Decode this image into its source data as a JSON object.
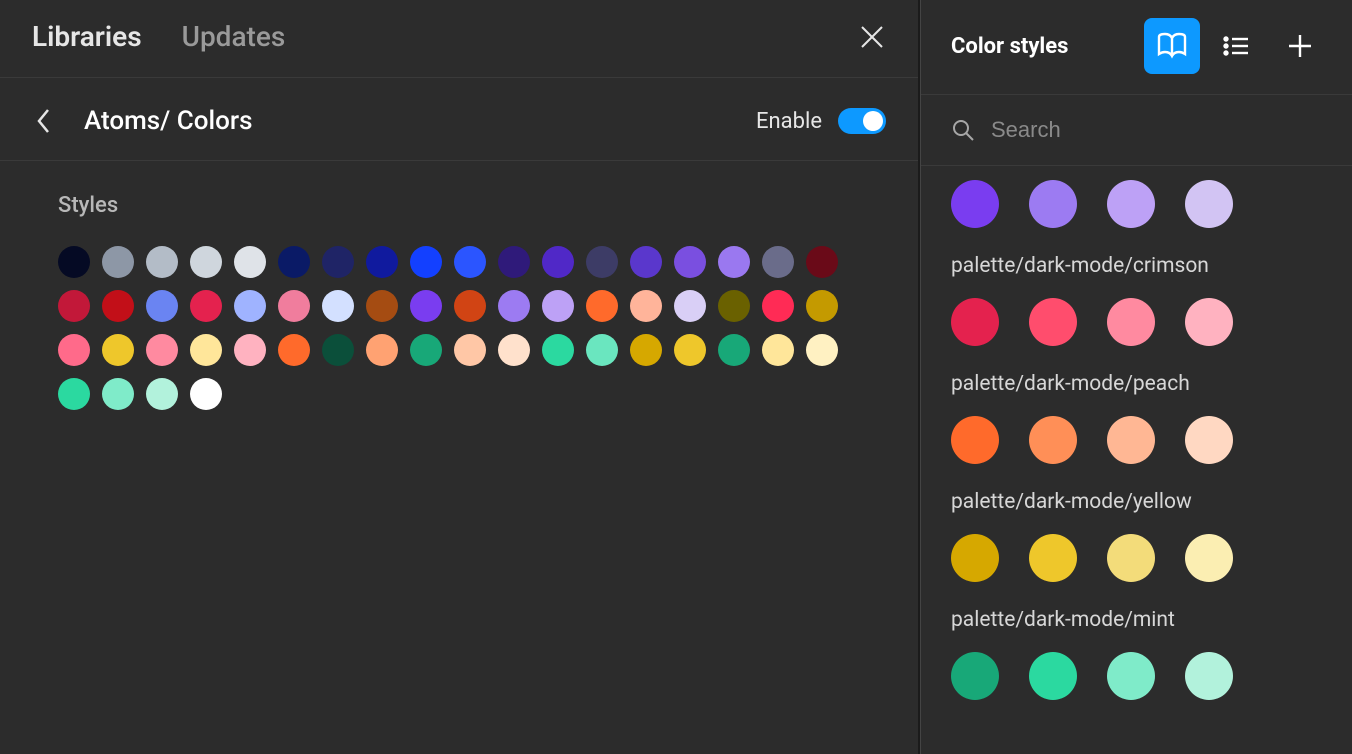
{
  "tabs": {
    "libraries": "Libraries",
    "updates": "Updates"
  },
  "library": {
    "title": "Atoms/ Colors",
    "enable_label": "Enable",
    "enabled": true
  },
  "styles_section": {
    "heading": "Styles",
    "swatches": [
      "#050a24",
      "#8d97a6",
      "#b3bcc7",
      "#cfd6dd",
      "#dfe3e8",
      "#0a1a66",
      "#1f2466",
      "#101a9e",
      "#1340ff",
      "#2b55ff",
      "#2f1a7a",
      "#5028c7",
      "#3d3c66",
      "#5a37cc",
      "#7a4fe0",
      "#9a78f0",
      "#6a6c8a",
      "#6a0a18",
      "#c21839",
      "#c20f18",
      "#6a84f2",
      "#e4224e",
      "#9fb3ff",
      "#f07d9d",
      "#d3e0ff",
      "#a54c12",
      "#7a3df0",
      "#d14414",
      "#9c7bf2",
      "#bda1f6",
      "#ff6a2b",
      "#ffb49a",
      "#d9cff6",
      "#6a6100",
      "#ff2b55",
      "#c49a00",
      "#ff6a8a",
      "#eec72b",
      "#ff8aa0",
      "#ffe69a",
      "#ffb2c0",
      "#ff6a2b",
      "#0b4f3a",
      "#ffa272",
      "#18a878",
      "#ffc7a6",
      "#ffe1cc",
      "#2bd9a0",
      "#6ae6bf",
      "#d6a800",
      "#eec72b",
      "#18a878",
      "#ffe69a",
      "#fff1c2",
      "#2bd9a0",
      "#7febc9",
      "#b2f2dc",
      "#ffffff"
    ]
  },
  "right_panel": {
    "title": "Color styles",
    "search_placeholder": "Search",
    "top_row": [
      "#7a3df0",
      "#9c7bf2",
      "#bda1f6",
      "#d2c4f3"
    ],
    "groups": [
      {
        "label": "palette/dark-mode/crimson",
        "colors": [
          "#e4224e",
          "#ff4d6d",
          "#ff8aa0",
          "#ffb2c0"
        ]
      },
      {
        "label": "palette/dark-mode/peach",
        "colors": [
          "#ff6a2b",
          "#ff8f57",
          "#ffb794",
          "#ffd8c2"
        ]
      },
      {
        "label": "palette/dark-mode/yellow",
        "colors": [
          "#d6a800",
          "#eec72b",
          "#f3dc7a",
          "#fbeeb2"
        ]
      },
      {
        "label": "palette/dark-mode/mint",
        "colors": [
          "#18a878",
          "#2bd9a0",
          "#7febc9",
          "#b2f2dc"
        ]
      }
    ]
  }
}
